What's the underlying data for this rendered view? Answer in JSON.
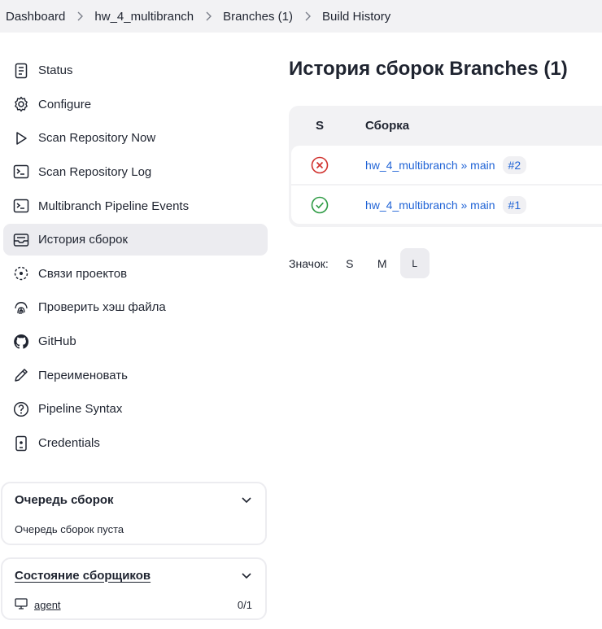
{
  "breadcrumb": {
    "items": [
      "Dashboard",
      "hw_4_multibranch",
      "Branches (1)",
      "Build History"
    ]
  },
  "sidebar": {
    "items": [
      {
        "label": "Status",
        "icon": "document-icon"
      },
      {
        "label": "Configure",
        "icon": "gear-icon"
      },
      {
        "label": "Scan Repository Now",
        "icon": "play-icon"
      },
      {
        "label": "Scan Repository Log",
        "icon": "terminal-icon"
      },
      {
        "label": "Multibranch Pipeline Events",
        "icon": "terminal-icon"
      },
      {
        "label": "История сборок",
        "icon": "inbox-icon",
        "active": true
      },
      {
        "label": "Связи проектов",
        "icon": "relationship-icon"
      },
      {
        "label": "Проверить хэш файла",
        "icon": "fingerprint-icon"
      },
      {
        "label": "GitHub",
        "icon": "github-icon"
      },
      {
        "label": "Переименовать",
        "icon": "pencil-icon"
      },
      {
        "label": "Pipeline Syntax",
        "icon": "help-icon"
      },
      {
        "label": "Credentials",
        "icon": "credentials-icon"
      }
    ]
  },
  "build_queue": {
    "title": "Очередь сборок",
    "empty_text": "Очередь сборок пуста"
  },
  "executors": {
    "title": "Состояние сборщиков",
    "agent_name": "agent",
    "agent_count": "0/1"
  },
  "main": {
    "title": "История сборок Branches (1)",
    "table": {
      "col_status": "S",
      "col_build": "Сборка",
      "rows": [
        {
          "status": "failed",
          "name": "hw_4_multibranch » main",
          "number": "#2",
          "color": "#d0312d"
        },
        {
          "status": "success",
          "name": "hw_4_multibranch » main",
          "number": "#1",
          "color": "#2e9b44"
        }
      ]
    },
    "icon_size": {
      "label": "Значок:",
      "options": [
        "S",
        "M",
        "L"
      ],
      "selected": "L"
    }
  },
  "colors": {
    "link": "#1f63d6",
    "failed": "#d0312d",
    "success": "#2e9b44",
    "panel": "#f2f2f4"
  }
}
